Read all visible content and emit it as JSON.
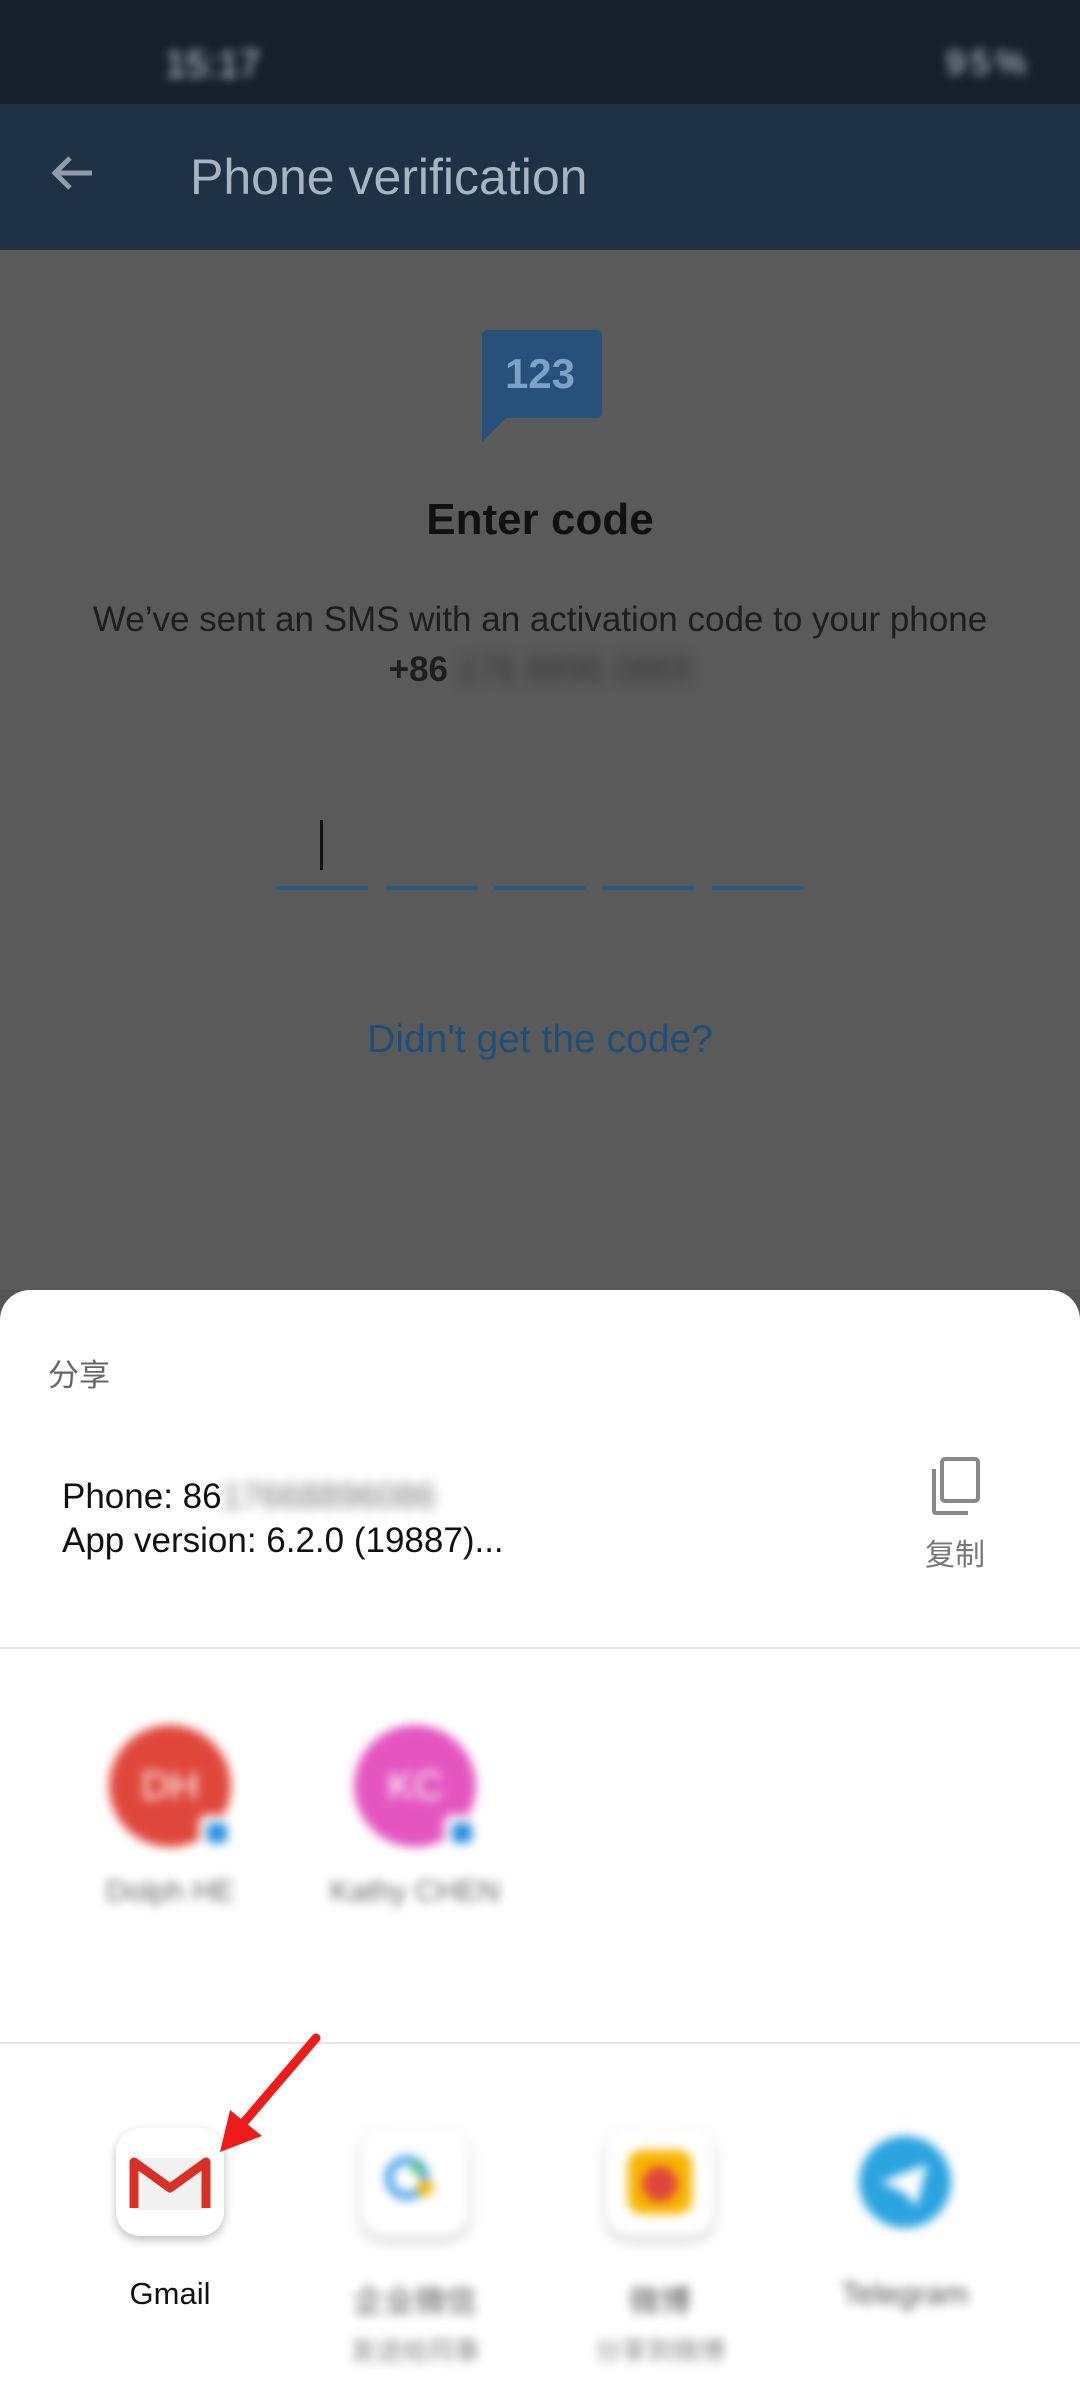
{
  "status_bar": {
    "time": "15:17",
    "battery": "95%"
  },
  "app_bar": {
    "title": "Phone verification",
    "back_icon": "arrow-left-icon"
  },
  "verification": {
    "badge_text": "123",
    "heading": "Enter code",
    "sent_message": "We’ve sent an SMS with an activation code to your phone",
    "phone_prefix": "+86",
    "phone_number": "176 8896 0869",
    "code_box_count": 5,
    "resend_link": "Didn't get the code?"
  },
  "share_sheet": {
    "title": "分享",
    "preview_line1_label": "Phone: 86",
    "preview_line1_value": "17668896086",
    "preview_line2": "App version: 6.2.0 (19887)...",
    "copy_label": "复制",
    "contacts": [
      {
        "initials": "DH",
        "name": "Dolph HE",
        "color": "#e0473b"
      },
      {
        "initials": "KC",
        "name": "Kathy CHEN",
        "color": "#e455c0"
      }
    ],
    "apps": [
      {
        "label": "Gmail",
        "sub": ""
      },
      {
        "label": "企业微信",
        "sub": "发送给同事"
      },
      {
        "label": "微博",
        "sub": "分享到微博"
      },
      {
        "label": "Telegram",
        "sub": ""
      }
    ]
  },
  "colors": {
    "accent": "#2a5b84",
    "arrow": "#ee1b1b",
    "telegram": "#2aa3df",
    "gmail_red": "#d93025"
  }
}
